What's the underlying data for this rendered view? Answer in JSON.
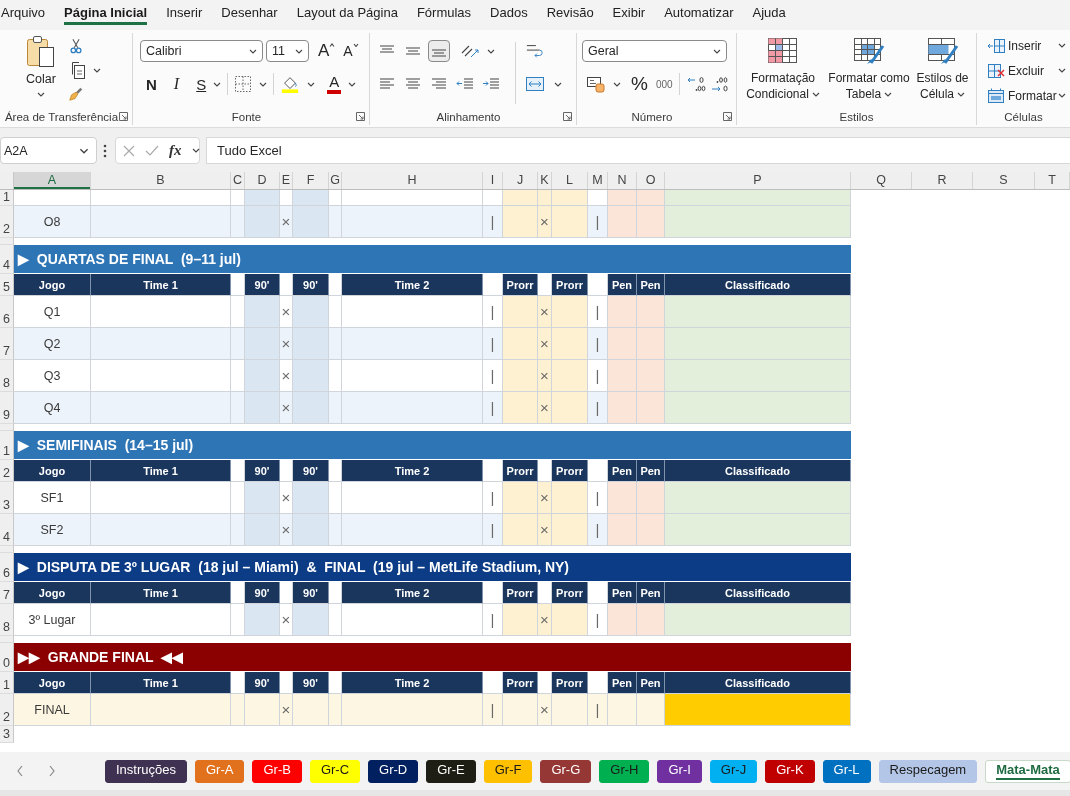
{
  "menu_tabs": [
    {
      "label": "Arquivo",
      "selected": false
    },
    {
      "label": "Página Inicial",
      "selected": true
    },
    {
      "label": "Inserir",
      "selected": false
    },
    {
      "label": "Desenhar",
      "selected": false
    },
    {
      "label": "Layout da Página",
      "selected": false
    },
    {
      "label": "Fórmulas",
      "selected": false
    },
    {
      "label": "Dados",
      "selected": false
    },
    {
      "label": "Revisão",
      "selected": false
    },
    {
      "label": "Exibir",
      "selected": false
    },
    {
      "label": "Automatizar",
      "selected": false
    },
    {
      "label": "Ajuda",
      "selected": false
    }
  ],
  "ribbon": {
    "clipboard": {
      "paste": "Colar",
      "label": "Área de Transferência"
    },
    "font": {
      "name": "Calibri",
      "size": "11",
      "grow": "A",
      "shrink": "A",
      "bold": "N",
      "italic": "I",
      "underline": "S",
      "font_color": "A",
      "label": "Fonte"
    },
    "alignment": {
      "vertical_align": [
        {
          "selected": false
        },
        {
          "selected": false
        },
        {
          "selected": true
        }
      ],
      "label": "Alinhamento"
    },
    "number": {
      "format": "Geral",
      "percent": "%",
      "thousands": "000",
      "label": "Número"
    },
    "styles": {
      "buttons": [
        "Formatação Condicional",
        "Formatar como Tabela",
        "Estilos de Célula"
      ],
      "label": "Estilos"
    },
    "cells": {
      "buttons": [
        "Inserir",
        "Excluir",
        "Formatar"
      ],
      "label": "Células"
    }
  },
  "formula_bar": {
    "name_box": "A2A",
    "function_label": "fx",
    "formula": "Tudo Excel"
  },
  "grid": {
    "columns": [
      {
        "label": "A",
        "selected": true
      },
      {
        "label": "B",
        "selected": false
      },
      {
        "label": "C",
        "selected": false
      },
      {
        "label": "D",
        "selected": false
      },
      {
        "label": "E",
        "selected": false
      },
      {
        "label": "F",
        "selected": false
      },
      {
        "label": "G",
        "selected": false
      },
      {
        "label": "H",
        "selected": false
      },
      {
        "label": "I",
        "selected": false
      },
      {
        "label": "J",
        "selected": false
      },
      {
        "label": "K",
        "selected": false
      },
      {
        "label": "L",
        "selected": false
      },
      {
        "label": "M",
        "selected": false
      },
      {
        "label": "N",
        "selected": false
      },
      {
        "label": "O",
        "selected": false
      },
      {
        "label": "P",
        "selected": false
      },
      {
        "label": "Q",
        "selected": false
      },
      {
        "label": "R",
        "selected": false
      },
      {
        "label": "S",
        "selected": false
      },
      {
        "label": "T",
        "selected": false
      }
    ],
    "rows": [
      {
        "kind": "cut",
        "number": "1",
        "banded": false
      },
      {
        "kind": "match",
        "number": "2",
        "banded": true,
        "game": "O8",
        "marks": [
          "×",
          "|",
          "×",
          "|"
        ]
      },
      {
        "kind": "gap"
      },
      {
        "kind": "section",
        "number": "4",
        "title": "▶  QUARTAS DE FINAL  (9–11 jul)",
        "color": "#2e75b6"
      },
      {
        "kind": "header",
        "number": "5",
        "cells": [
          "Jogo",
          "Time 1",
          "90'",
          "90'",
          "Time 2",
          "Prorr",
          "Prorr",
          "Pen",
          "Pen",
          "Classificado"
        ]
      },
      {
        "kind": "match",
        "number": "6",
        "banded": false,
        "game": "Q1",
        "marks": [
          "×",
          "|",
          "×",
          "|"
        ]
      },
      {
        "kind": "match",
        "number": "7",
        "banded": true,
        "game": "Q2",
        "marks": [
          "×",
          "|",
          "×",
          "|"
        ]
      },
      {
        "kind": "match",
        "number": "8",
        "banded": false,
        "game": "Q3",
        "marks": [
          "×",
          "|",
          "×",
          "|"
        ]
      },
      {
        "kind": "match",
        "number": "9",
        "banded": true,
        "game": "Q4",
        "marks": [
          "×",
          "|",
          "×",
          "|"
        ]
      },
      {
        "kind": "gap"
      },
      {
        "kind": "section",
        "number": "1",
        "title": "▶  SEMIFINAIS  (14–15 jul)",
        "color": "#2e75b6"
      },
      {
        "kind": "header",
        "number": "2",
        "cells": [
          "Jogo",
          "Time 1",
          "90'",
          "90'",
          "Time 2",
          "Prorr",
          "Prorr",
          "Pen",
          "Pen",
          "Classificado"
        ]
      },
      {
        "kind": "match",
        "number": "3",
        "banded": false,
        "game": "SF1",
        "marks": [
          "×",
          "|",
          "×",
          "|"
        ]
      },
      {
        "kind": "match",
        "number": "4",
        "banded": true,
        "game": "SF2",
        "marks": [
          "×",
          "|",
          "×",
          "|"
        ]
      },
      {
        "kind": "gap"
      },
      {
        "kind": "section",
        "number": "6",
        "title": "▶  DISPUTA DE 3º LUGAR  (18 jul – Miami)  &  FINAL  (19 jul – MetLife Stadium, NY)",
        "color": "#0b3c85"
      },
      {
        "kind": "header",
        "number": "7",
        "cells": [
          "Jogo",
          "Time 1",
          "90'",
          "90'",
          "Time 2",
          "Prorr",
          "Prorr",
          "Pen",
          "Pen",
          "Classificado"
        ]
      },
      {
        "kind": "match",
        "number": "8",
        "banded": false,
        "game": "3º Lugar",
        "marks": [
          "×",
          "|",
          "×",
          "|"
        ]
      },
      {
        "kind": "gap"
      },
      {
        "kind": "section",
        "number": "0",
        "title": "▶▶  GRANDE FINAL  ◀◀",
        "color": "#8b0000"
      },
      {
        "kind": "header",
        "number": "1",
        "cells": [
          "Jogo",
          "Time 1",
          "90'",
          "90'",
          "Time 2",
          "Prorr",
          "Prorr",
          "Pen",
          "Pen",
          "Classificado"
        ]
      },
      {
        "kind": "final",
        "number": "2",
        "game": "FINAL",
        "marks": [
          "×",
          "|",
          "×",
          "|"
        ]
      },
      {
        "kind": "blank",
        "number": "3"
      }
    ]
  },
  "sheet_tabs": [
    {
      "label": "Instruções",
      "color": "#3f3151",
      "selected": false
    },
    {
      "label": "Gr-A",
      "color": "#e2711d",
      "selected": false
    },
    {
      "label": "Gr-B",
      "color": "#ff0000",
      "selected": false
    },
    {
      "label": "Gr-C",
      "color": "#ffff00",
      "selected": false
    },
    {
      "label": "Gr-D",
      "color": "#002060",
      "selected": false
    },
    {
      "label": "Gr-E",
      "color": "#1e1e14",
      "selected": false
    },
    {
      "label": "Gr-F",
      "color": "#ffc000",
      "selected": false
    },
    {
      "label": "Gr-G",
      "color": "#953735",
      "selected": false
    },
    {
      "label": "Gr-H",
      "color": "#00b050",
      "selected": false
    },
    {
      "label": "Gr-I",
      "color": "#7030a0",
      "selected": false
    },
    {
      "label": "Gr-J",
      "color": "#00b0f0",
      "selected": false
    },
    {
      "label": "Gr-K",
      "color": "#c00000",
      "selected": false
    },
    {
      "label": "Gr-L",
      "color": "#0070c0",
      "selected": false
    },
    {
      "label": "Respecagem",
      "color": "#b4c6e7",
      "selected": false
    },
    {
      "label": "Mata-Mata",
      "selected": true
    }
  ]
}
